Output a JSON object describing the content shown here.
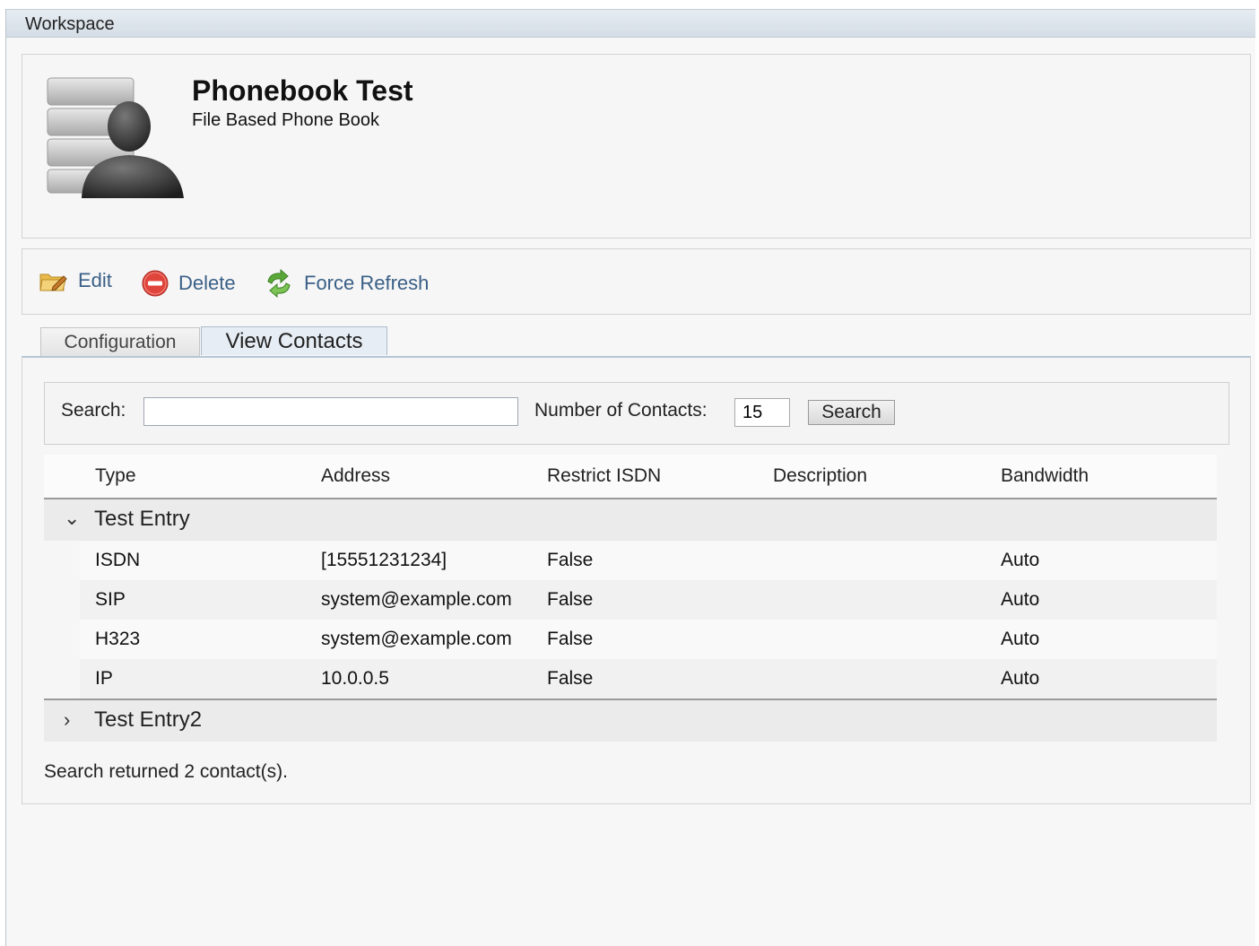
{
  "workspace": {
    "title": "Workspace"
  },
  "phonebook": {
    "name": "Phonebook Test",
    "type": "File Based Phone Book",
    "icon": "phonebook-contact-icon"
  },
  "actions": {
    "edit": {
      "label": "Edit",
      "icon": "folder-edit-icon"
    },
    "delete": {
      "label": "Delete",
      "icon": "delete-circle-icon"
    },
    "refresh": {
      "label": "Force Refresh",
      "icon": "refresh-arrows-icon"
    }
  },
  "tabs": [
    {
      "label": "Configuration",
      "active": false
    },
    {
      "label": "View Contacts",
      "active": true
    }
  ],
  "search": {
    "label": "Search:",
    "value": "",
    "count_label": "Number of Contacts:",
    "count_value": "15",
    "button": "Search"
  },
  "grid": {
    "columns": [
      "Type",
      "Address",
      "Restrict ISDN",
      "Description",
      "Bandwidth"
    ],
    "groups": [
      {
        "name": "Test Entry",
        "expanded": true,
        "rows": [
          {
            "type": "ISDN",
            "address": "[15551231234]",
            "restrict": "False",
            "description": "",
            "bandwidth": "Auto"
          },
          {
            "type": "SIP",
            "address": "system@example.com",
            "restrict": "False",
            "description": "",
            "bandwidth": "Auto"
          },
          {
            "type": "H323",
            "address": "system@example.com",
            "restrict": "False",
            "description": "",
            "bandwidth": "Auto"
          },
          {
            "type": "IP",
            "address": "10.0.0.5",
            "restrict": "False",
            "description": "",
            "bandwidth": "Auto"
          }
        ]
      },
      {
        "name": "Test Entry2",
        "expanded": false,
        "rows": []
      }
    ]
  },
  "status": "Search returned 2 contact(s).",
  "colors": {
    "link": "#3a5f86",
    "header_bg": "#d4dde6",
    "delete_red": "#e0453b",
    "refresh_green": "#5aa83a"
  }
}
